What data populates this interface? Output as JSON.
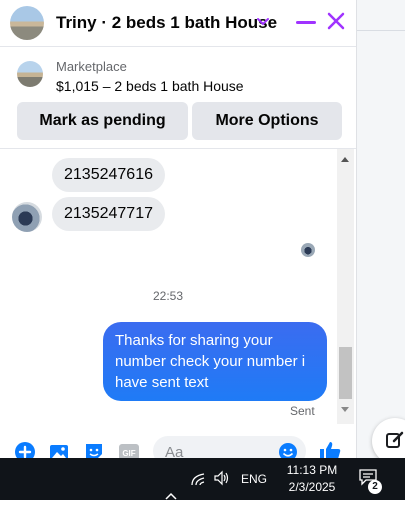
{
  "header": {
    "title": "Triny · 2 beds 1 bath House"
  },
  "listing": {
    "label": "Marketplace",
    "price_title": "$1,015 – 2 beds 1 bath House",
    "buttons": {
      "pending": "Mark as pending",
      "more": "More Options"
    }
  },
  "messages": {
    "incoming": [
      "2135247616",
      "2135247717"
    ],
    "timestamp": "22:53",
    "outgoing": "Thanks for sharing your number check your number i have sent text",
    "status": "Sent"
  },
  "composer": {
    "placeholder": "Aa",
    "gif_label": "GIF"
  },
  "taskbar": {
    "language": "ENG",
    "time": "11:13 PM",
    "date": "2/3/2025",
    "notification_count": "2"
  },
  "colors": {
    "accent": "#a033ff",
    "messenger_blue": "#0a7cff",
    "bubble_gray": "#e9ebee",
    "taskbar": "#101419"
  },
  "icons": [
    "chevron-down-icon",
    "minimize-icon",
    "close-icon",
    "plus-icon",
    "image-icon",
    "sticker-icon",
    "gif-icon",
    "emoji-icon",
    "thumbs-up-icon",
    "edit-icon",
    "chevron-up-icon",
    "wifi-icon",
    "volume-icon",
    "notification-icon"
  ]
}
